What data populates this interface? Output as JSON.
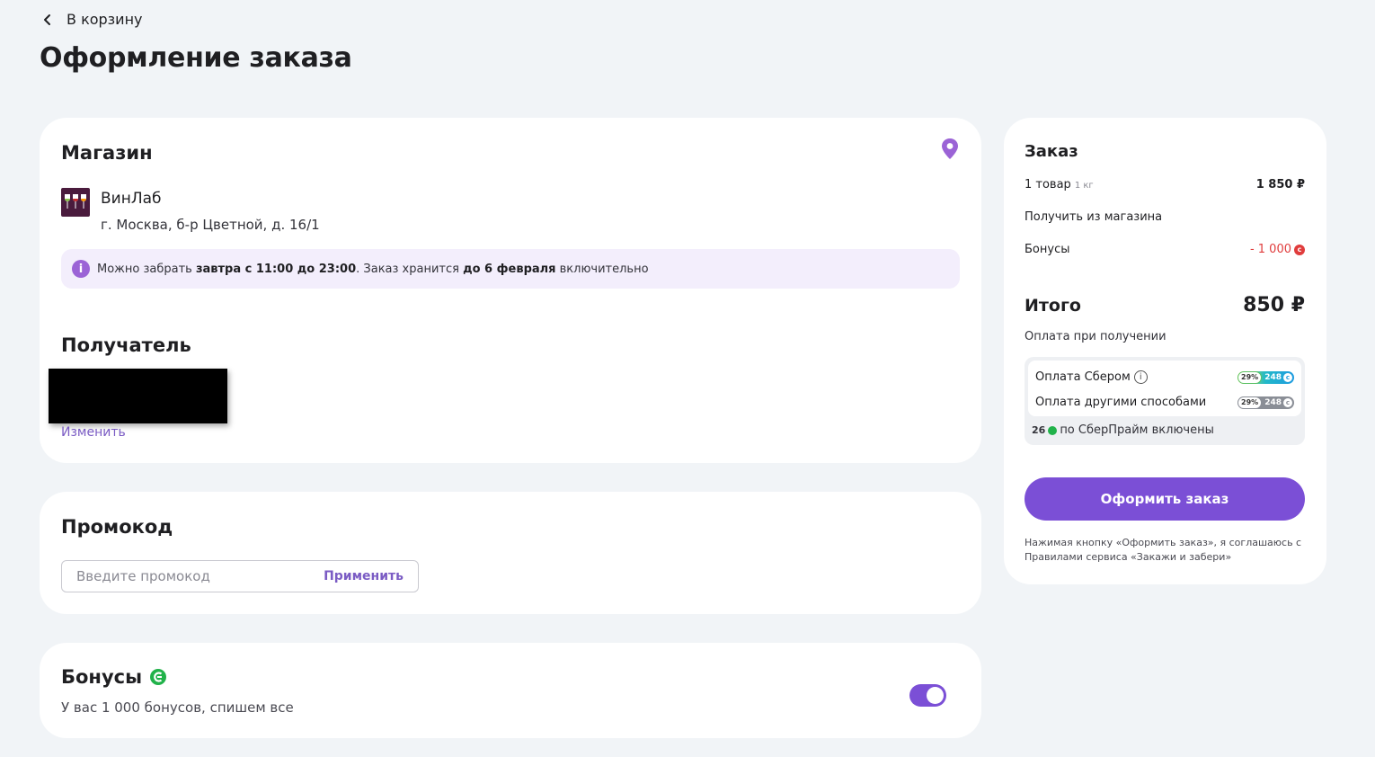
{
  "header": {
    "back_label": "В корзину",
    "page_title": "Оформление заказа"
  },
  "store": {
    "section_title": "Магазин",
    "name": "ВинЛаб",
    "address": "г. Москва, б-р Цветной, д. 16/1",
    "info": {
      "prefix": "Можно забрать ",
      "time": "завтра с 11:00 до 23:00",
      "middle": ". Заказ хранится ",
      "until": "до 6 февраля",
      "suffix": " включительно"
    }
  },
  "recipient": {
    "section_title": "Получатель",
    "change_label": "Изменить"
  },
  "promo": {
    "section_title": "Промокод",
    "placeholder": "Введите промокод",
    "apply_label": "Применить"
  },
  "bonuses": {
    "section_title": "Бонусы",
    "description": "У вас 1 000 бонусов, спишем все",
    "toggle_on": true
  },
  "order": {
    "title": "Заказ",
    "items_label": "1 товар",
    "items_weight": "1 кг",
    "items_price": "1 850 ₽",
    "pickup_label": "Получить из магазина",
    "bonus_label": "Бонусы",
    "bonus_value": "- 1 000",
    "total_label": "Итого",
    "total_value": "850 ₽",
    "payment_note": "Оплата при получении",
    "cashback": {
      "sber_label": "Оплата Сбером",
      "sber_pct": "29%",
      "sber_amount": "248",
      "other_label": "Оплата другими способами",
      "other_pct": "29%",
      "other_amount": "248",
      "prime_amount": "26",
      "prime_label": "по СберПрайм включены"
    },
    "checkout_label": "Оформить заказ",
    "agreement": "Нажимая кнопку «Оформить заказ», я соглашаюсь с Правилами сервиса «Закажи и забери»"
  },
  "colors": {
    "accent": "#7b4fd6",
    "link": "#7b5cc4",
    "negative": "#e03c3c",
    "background": "#f1f4f7"
  }
}
